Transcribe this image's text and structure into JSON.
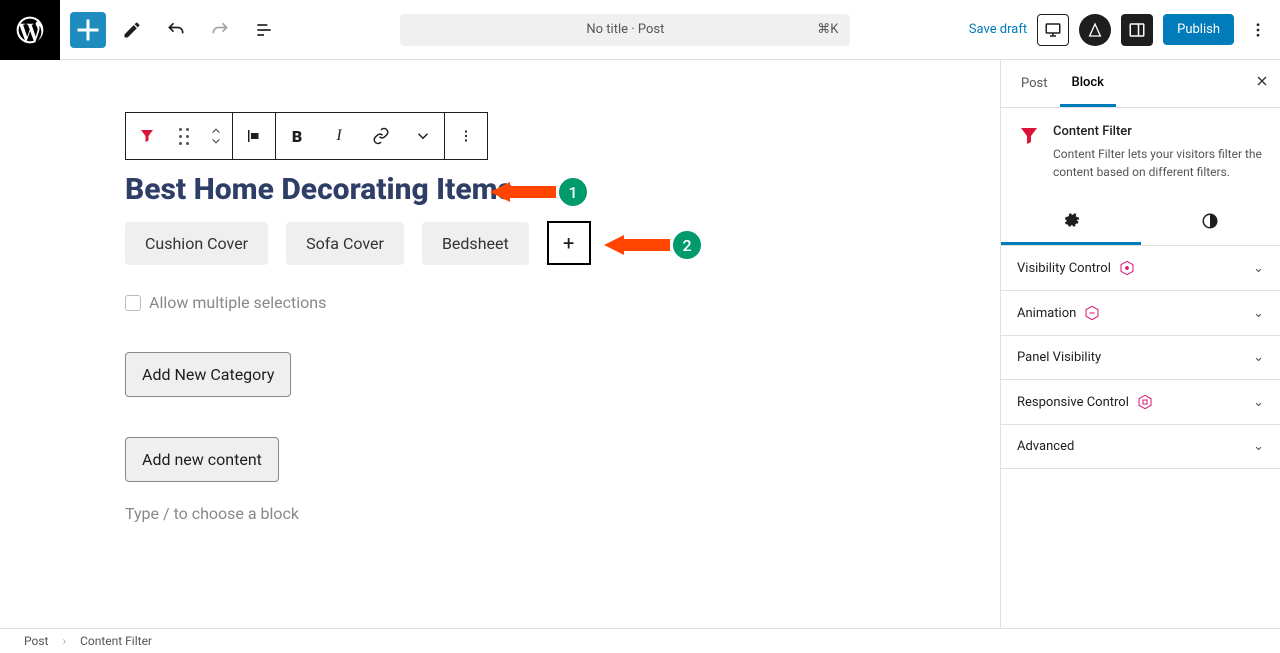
{
  "topbar": {
    "doc_title": "No title · Post",
    "shortcut": "⌘K",
    "save_draft": "Save draft",
    "publish": "Publish"
  },
  "editor": {
    "heading": "Best Home Decorating Items",
    "chips": [
      "Cushion Cover",
      "Sofa Cover",
      "Bedsheet"
    ],
    "add_chip": "+",
    "allow_multi": "Allow multiple selections",
    "add_category": "Add New Category",
    "add_content": "Add new content",
    "placeholder": "Type / to choose a block"
  },
  "annotations": {
    "badge1": "1",
    "badge2": "2"
  },
  "sidebar": {
    "tabs": {
      "post": "Post",
      "block": "Block"
    },
    "block_name": "Content Filter",
    "block_desc": "Content Filter lets your visitors filter the content based on different filters.",
    "panels": {
      "visibility": "Visibility Control",
      "animation": "Animation",
      "panel_visibility": "Panel Visibility",
      "responsive": "Responsive Control",
      "advanced": "Advanced"
    }
  },
  "footer": {
    "post": "Post",
    "block": "Content Filter"
  }
}
